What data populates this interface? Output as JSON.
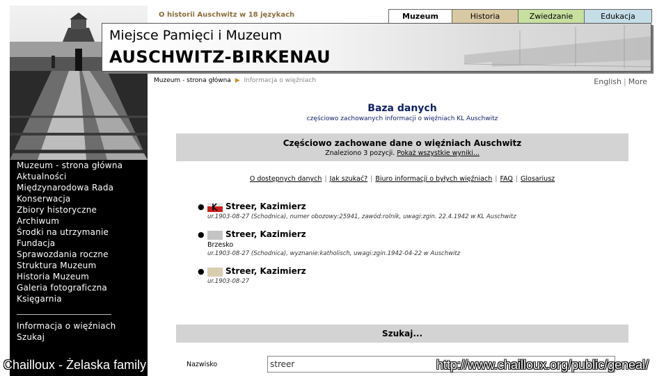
{
  "header": {
    "top_link": "O historii Auschwitz w 18 językach",
    "tabs": [
      {
        "label": "Muzeum",
        "color": "#ffffff"
      },
      {
        "label": "Historia",
        "color": "#d9c9a3"
      },
      {
        "label": "Zwiedzanie",
        "color": "#c7df9f"
      },
      {
        "label": "Edukacja",
        "color": "#c5dde6"
      }
    ],
    "banner_line1": "Miejsce Pamięci i Muzeum",
    "banner_line2": "AUSCHWITZ-BIRKENAU"
  },
  "sidebar": {
    "items": [
      "Muzeum - strona główna",
      "Aktualności",
      "Międzynarodowa Rada",
      "Konserwacja",
      "Zbiory historyczne",
      "Archiwum",
      "Środki na utrzymanie",
      "Fundacja",
      "Sprawozdania roczne",
      "Struktura Muzeum",
      "Historia Muzeum",
      "Galeria fotograficzna",
      "Księgarnia"
    ],
    "items2": [
      "Informacja o więźniach",
      "Szukaj"
    ]
  },
  "breadcrumb": {
    "home": "Muzeum - strona główna",
    "arrow": "▶",
    "current": "Informacja o więźniach"
  },
  "languages": {
    "english": "English",
    "separator": "|",
    "more": "More"
  },
  "main": {
    "title": "Baza danych",
    "subtitle": "częściowo zachowanych informacji o więźniach KL Auschwitz",
    "result_title": "Częściowo zachowane dane o więźniach Auschwitz",
    "result_count": "Znaleziono 3 pozycji.",
    "show_all": "Pokaż wszystkie wyniki...",
    "links": [
      "O dostępnych danych",
      "Jak szukać?",
      "Biuro informacji o byłych więźniach",
      "FAQ",
      "Glosariusz"
    ],
    "link_separator": "|",
    "bullet": "●",
    "records": [
      {
        "name": "Streer, Kazimierz",
        "flag": "red-marked",
        "flag_color": "#cc1f1f",
        "place": "",
        "detail": "ur.1903-08-27 (Schodnica), numer obozowy:25941, zawód:rolnik, uwagi:zgin. 22.4.1942 w KL Auschwitz"
      },
      {
        "name": "Streer, Kazimierz",
        "flag": "grey",
        "flag_color": "#c4c4c4",
        "place": "Brzesko",
        "detail": "ur.1903-08-27 (Schodnica), wyznanie:katholisch, uwagi:zgin.1942-04-22 w Auschwitz"
      },
      {
        "name": "Streer, Kazimierz",
        "flag": "beige",
        "flag_color": "#d8cdb0",
        "place": "",
        "detail": "ur.1903-08-27"
      }
    ],
    "search_title": "Szukaj...",
    "name_label": "Nazwisko",
    "name_value": "streer"
  },
  "watermark": {
    "left": "Chailloux - Żelaska  family",
    "right": "http://www.chailloux.org/public/geneal/"
  }
}
